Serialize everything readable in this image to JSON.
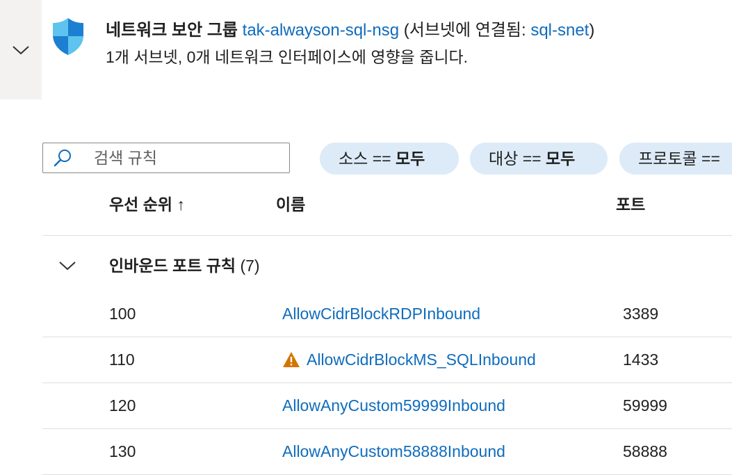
{
  "header": {
    "title_prefix": "네트워크 보안 그룹",
    "nsg_name": "tak-alwayson-sql-nsg",
    "attached_prefix": "(서브넷에 연결됨: ",
    "subnet_name": "sql-snet",
    "attached_suffix": ")",
    "subtitle": "1개 서브넷, 0개 네트워크 인터페이스에 영향을 줍니다."
  },
  "search": {
    "placeholder": "검색 규칙",
    "value": ""
  },
  "filters": [
    {
      "label": "소스 == ",
      "value": "모두"
    },
    {
      "label": "대상 == ",
      "value": "모두"
    },
    {
      "label": "프로토콜 ==",
      "value": ""
    }
  ],
  "columns": {
    "priority": "우선 순위 ↑",
    "name": "이름",
    "port": "포트"
  },
  "group": {
    "label": "인바운드 포트 규칙",
    "count": "(7)"
  },
  "rows": [
    {
      "priority": "100",
      "name": "AllowCidrBlockRDPInbound",
      "port": "3389",
      "warning": false
    },
    {
      "priority": "110",
      "name": "AllowCidrBlockMS_SQLInbound",
      "port": "1433",
      "warning": true
    },
    {
      "priority": "120",
      "name": "AllowAnyCustom59999Inbound",
      "port": "59999",
      "warning": false
    },
    {
      "priority": "130",
      "name": "AllowAnyCustom58888Inbound",
      "port": "58888",
      "warning": false
    }
  ],
  "colors": {
    "link": "#0f6cbd",
    "pill_bg": "#dcebf7",
    "side_bar": "#f3f2f1",
    "warning": "#d47500",
    "shield_dark": "#1c7fd1",
    "shield_light": "#5ec3ee"
  },
  "icons": {
    "collapse": "chevron-down-icon",
    "shield": "shield-icon",
    "search": "search-icon",
    "warning": "warning-icon"
  }
}
